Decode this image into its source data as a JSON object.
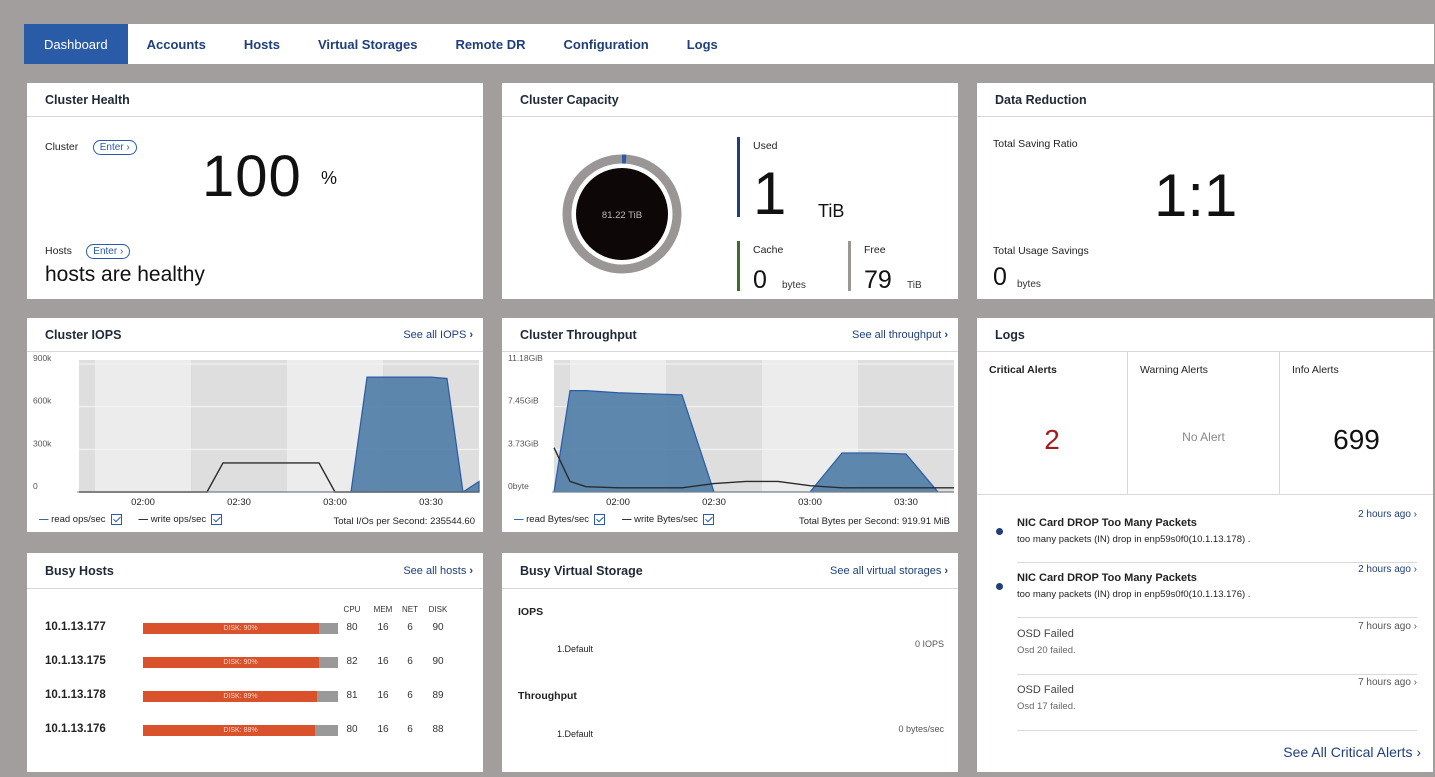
{
  "nav": {
    "tabs": [
      "Dashboard",
      "Accounts",
      "Hosts",
      "Virtual Storages",
      "Remote DR",
      "Configuration",
      "Logs"
    ],
    "active": "Dashboard"
  },
  "cluster_health": {
    "title": "Cluster Health",
    "cluster_label": "Cluster",
    "enter_label": "Enter ›",
    "percent_value": "100",
    "percent_unit": "%",
    "hosts_label": "Hosts",
    "hosts_status": "hosts are healthy"
  },
  "cluster_capacity": {
    "title": "Cluster Capacity",
    "donut_label": "81.22 TiB",
    "used_fraction": 0.012,
    "used_label": "Used",
    "used_value": "1",
    "used_unit": "TiB",
    "cache_label": "Cache",
    "cache_value": "0",
    "cache_unit": "bytes",
    "free_label": "Free",
    "free_value": "79",
    "free_unit": "TiB"
  },
  "data_reduction": {
    "title": "Data Reduction",
    "saving_ratio_label": "Total Saving Ratio",
    "saving_ratio_value": "1:1",
    "usage_savings_label": "Total Usage Savings",
    "usage_savings_value": "0",
    "usage_savings_unit": "bytes"
  },
  "cluster_iops": {
    "title": "Cluster IOPS",
    "link": "See all IOPS",
    "legend_read": "read ops/sec",
    "legend_write": "write ops/sec",
    "total": "Total I/Os per Second: 235544.60"
  },
  "cluster_throughput": {
    "title": "Cluster Throughput",
    "link": "See all throughput",
    "legend_read": "read Bytes/sec",
    "legend_write": "write Bytes/sec",
    "total": "Total Bytes per Second: 919.91 MiB"
  },
  "chart_data": [
    {
      "type": "area",
      "x": [
        "01:40",
        "01:50",
        "02:00",
        "02:10",
        "02:20",
        "02:25",
        "02:30",
        "02:40",
        "02:50",
        "02:55",
        "03:00",
        "03:05",
        "03:10",
        "03:20",
        "03:30",
        "03:35",
        "03:40",
        "03:45"
      ],
      "xticks": [
        "02:00",
        "02:30",
        "03:00",
        "03:30"
      ],
      "yticks": [
        "0",
        "300k",
        "600k",
        "900k"
      ],
      "ylim": [
        0,
        1000000
      ],
      "series": [
        {
          "name": "read ops/sec",
          "values": [
            0,
            0,
            0,
            0,
            0,
            0,
            0,
            0,
            0,
            0,
            0,
            0,
            870000,
            870000,
            870000,
            860000,
            0,
            80000
          ]
        },
        {
          "name": "write ops/sec",
          "values": [
            0,
            0,
            0,
            0,
            0,
            220000,
            220000,
            220000,
            220000,
            220000,
            0,
            0,
            0,
            0,
            0,
            0,
            0,
            0
          ]
        }
      ]
    },
    {
      "type": "area",
      "x": [
        "01:40",
        "01:45",
        "01:50",
        "02:00",
        "02:10",
        "02:20",
        "02:30",
        "02:40",
        "02:50",
        "03:00",
        "03:10",
        "03:20",
        "03:30",
        "03:40",
        "03:45"
      ],
      "xticks": [
        "02:00",
        "02:30",
        "03:00",
        "03:30"
      ],
      "yticks": [
        "0byte",
        "3.73GiB",
        "7.45GiB",
        "11.18GiB"
      ],
      "ylim": [
        0,
        12.5
      ],
      "series": [
        {
          "name": "read Bytes/sec",
          "values": [
            0,
            9.6,
            9.6,
            9.4,
            9.3,
            9.2,
            0,
            0,
            0,
            0,
            3.7,
            3.7,
            3.6,
            0,
            0
          ]
        },
        {
          "name": "write Bytes/sec",
          "values": [
            4.2,
            1.0,
            0.5,
            0.4,
            0.4,
            0.4,
            0.8,
            1.0,
            1.0,
            0.6,
            0.4,
            0.4,
            0.4,
            0.4,
            0.4
          ]
        }
      ]
    }
  ],
  "logs": {
    "title": "Logs",
    "critical_label": "Critical Alerts",
    "critical_value": "2",
    "warning_label": "Warning Alerts",
    "warning_value": "No Alert",
    "info_label": "Info Alerts",
    "info_value": "699",
    "items": [
      {
        "title": "NIC Card DROP Too Many Packets",
        "desc": "too many packets (IN) drop in enp59s0f0(10.1.13.178) .",
        "time": "2 hours ago ›"
      },
      {
        "title": "NIC Card DROP Too Many Packets",
        "desc": "too many packets (IN) drop in enp59s0f0(10.1.13.176) .",
        "time": "2 hours ago ›"
      },
      {
        "title": "OSD Failed",
        "desc": "Osd 20 failed.",
        "time": "7 hours ago ›"
      },
      {
        "title": "OSD Failed",
        "desc": "Osd 17 failed.",
        "time": "7 hours ago ›"
      }
    ],
    "see_all": "See All Critical Alerts ›"
  },
  "busy_hosts": {
    "title": "Busy Hosts",
    "link": "See all hosts",
    "columns": [
      "CPU",
      "MEM",
      "NET",
      "DISK"
    ],
    "rows": [
      {
        "ip": "10.1.13.177",
        "bar_label": "DISK: 90%",
        "disk_fraction": 0.9,
        "cpu": "80",
        "mem": "16",
        "net": "6",
        "disk": "90"
      },
      {
        "ip": "10.1.13.175",
        "bar_label": "DISK: 90%",
        "disk_fraction": 0.9,
        "cpu": "82",
        "mem": "16",
        "net": "6",
        "disk": "90"
      },
      {
        "ip": "10.1.13.178",
        "bar_label": "DISK: 89%",
        "disk_fraction": 0.89,
        "cpu": "81",
        "mem": "16",
        "net": "6",
        "disk": "89"
      },
      {
        "ip": "10.1.13.176",
        "bar_label": "DISK: 88%",
        "disk_fraction": 0.88,
        "cpu": "80",
        "mem": "16",
        "net": "6",
        "disk": "88"
      }
    ]
  },
  "busy_virtual_storage": {
    "title": "Busy Virtual Storage",
    "link": "See all virtual storages",
    "iops_label": "IOPS",
    "iops_name": "1.Default",
    "iops_value": "0 IOPS",
    "throughput_label": "Throughput",
    "throughput_name": "1.Default",
    "throughput_value": "0 bytes/sec"
  },
  "colors": {
    "accent": "#2a5ba6",
    "nav_text": "#1f3f7a",
    "area_fill": "#4f7ca6",
    "critical": "#a31b1b",
    "disk_bar": "#d9522b"
  }
}
